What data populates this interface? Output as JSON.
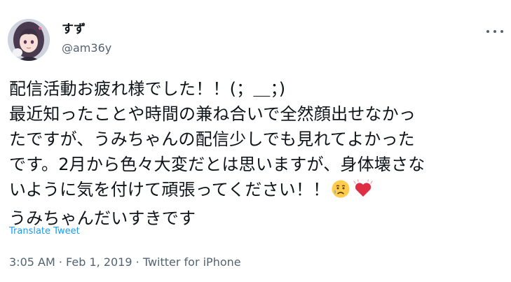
{
  "tweet": {
    "display_name": "すず",
    "handle": "@am36y",
    "body_lines": [
      "配信活動お疲れ様でした！！(；＿；)",
      "最近知ったことや時間の兼ね合いで全然顔出せなかっ",
      "たですが、うみちゃんの配信少しでも見れてよかった",
      "です。2月から色々大変だとは思いますが、身体壊さな",
      "いように気を付けて頑張ってください！！",
      "うみちゃんだいすきです"
    ],
    "emojis": [
      "crying-face-emoji",
      "beating-heart-emoji"
    ],
    "translate_label": "Translate Tweet",
    "time": "3:05 AM",
    "separator": "·",
    "date": "Feb 1, 2019",
    "source": "Twitter for iPhone",
    "colors": {
      "text": "#0f1419",
      "secondary": "#536471",
      "link": "#1d9bf0"
    }
  }
}
